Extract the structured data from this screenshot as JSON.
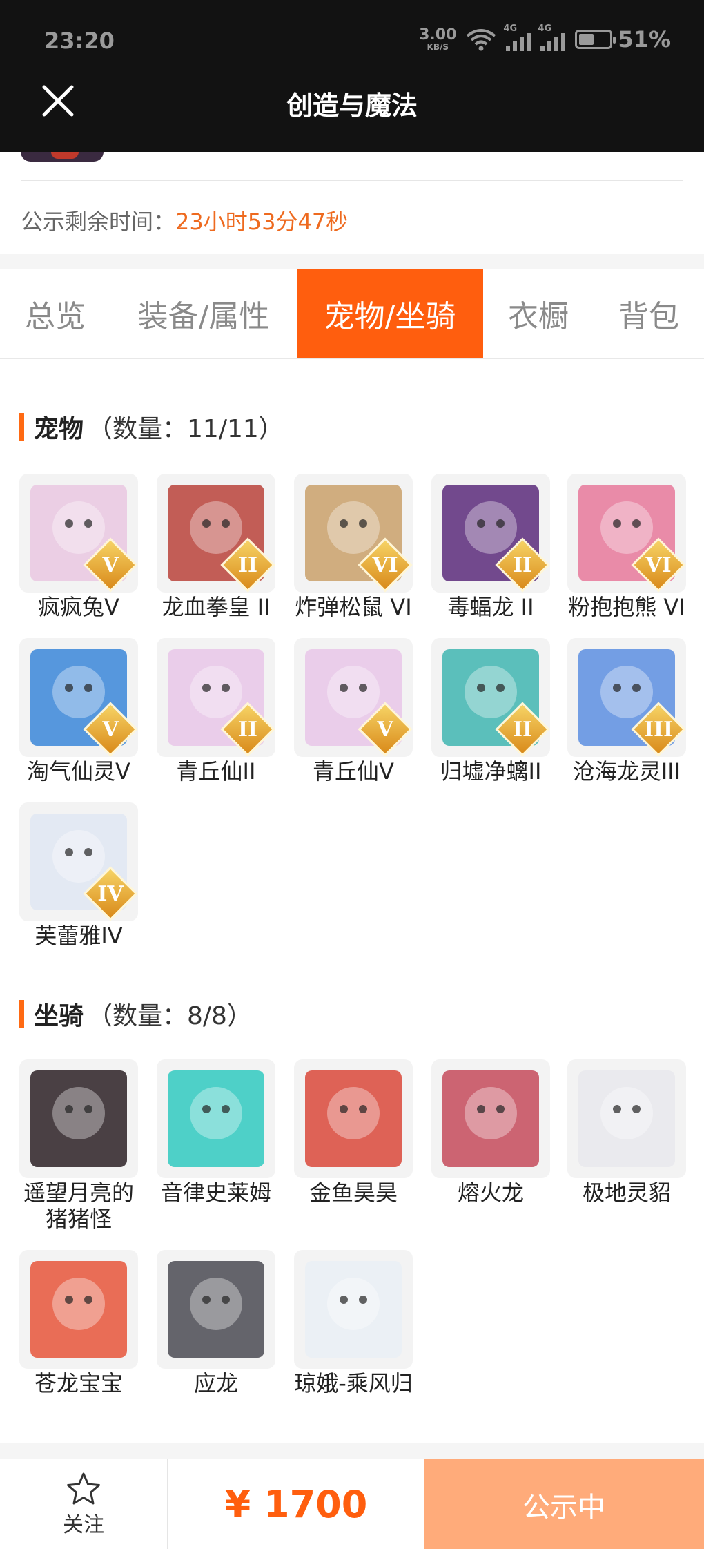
{
  "status_bar": {
    "time": "23:20",
    "speed_value": "3.00",
    "speed_unit": "KB/S",
    "net1": "4G",
    "net2": "4G",
    "battery": "51%",
    "battery_level": 0.51
  },
  "header": {
    "title": "创造与魔法"
  },
  "notice": {
    "label": "公示剩余时间：",
    "value": "23小时53分47秒"
  },
  "tabs": [
    {
      "label": "总览",
      "active": false
    },
    {
      "label": "装备/属性",
      "active": false
    },
    {
      "label": "宠物/坐骑",
      "active": true
    },
    {
      "label": "衣橱",
      "active": false
    },
    {
      "label": "背包",
      "active": false
    }
  ],
  "pets": {
    "title": "宠物",
    "count": "（数量：11/11）",
    "items": [
      {
        "name": "疯疯兔V",
        "badge": "V",
        "color": "#e9c7e0"
      },
      {
        "name": "龙血拳皇 II",
        "badge": "II",
        "color": "#b8423a"
      },
      {
        "name": "炸弹松鼠 VI",
        "badge": "VI",
        "color": "#c9a06a"
      },
      {
        "name": "毒蝠龙 II",
        "badge": "II",
        "color": "#5a2a7a"
      },
      {
        "name": "粉抱抱熊 VI",
        "badge": "VI",
        "color": "#e6789a"
      },
      {
        "name": "淘气仙灵V",
        "badge": "V",
        "color": "#3a86d8"
      },
      {
        "name": "青丘仙II",
        "badge": "II",
        "color": "#e7c6e8"
      },
      {
        "name": "青丘仙V",
        "badge": "V",
        "color": "#e7c6e8"
      },
      {
        "name": "归墟净螭II",
        "badge": "II",
        "color": "#3fb5b0"
      },
      {
        "name": "沧海龙灵III",
        "badge": "III",
        "color": "#5c8ee0"
      },
      {
        "name": "芙蕾雅IV",
        "badge": "IV",
        "color": "#dfe6f2"
      }
    ]
  },
  "mounts": {
    "title": "坐骑",
    "count": "（数量：8/8）",
    "items": [
      {
        "name": "遥望月亮的猪猪怪",
        "color": "#2b2024"
      },
      {
        "name": "音律史莱姆",
        "color": "#30c9c0"
      },
      {
        "name": "金鱼昊昊",
        "color": "#d9483a"
      },
      {
        "name": "熔火龙",
        "color": "#c44a5a"
      },
      {
        "name": "极地灵貂",
        "color": "#e8e8ec"
      },
      {
        "name": "苍龙宝宝",
        "color": "#e6553a"
      },
      {
        "name": "应龙",
        "color": "#4a4a52"
      },
      {
        "name": "琼娥-乘风归",
        "color": "#e9eef5"
      }
    ]
  },
  "bottom": {
    "follow_label": "关注",
    "price": "¥ 1700",
    "status_label": "公示中"
  }
}
